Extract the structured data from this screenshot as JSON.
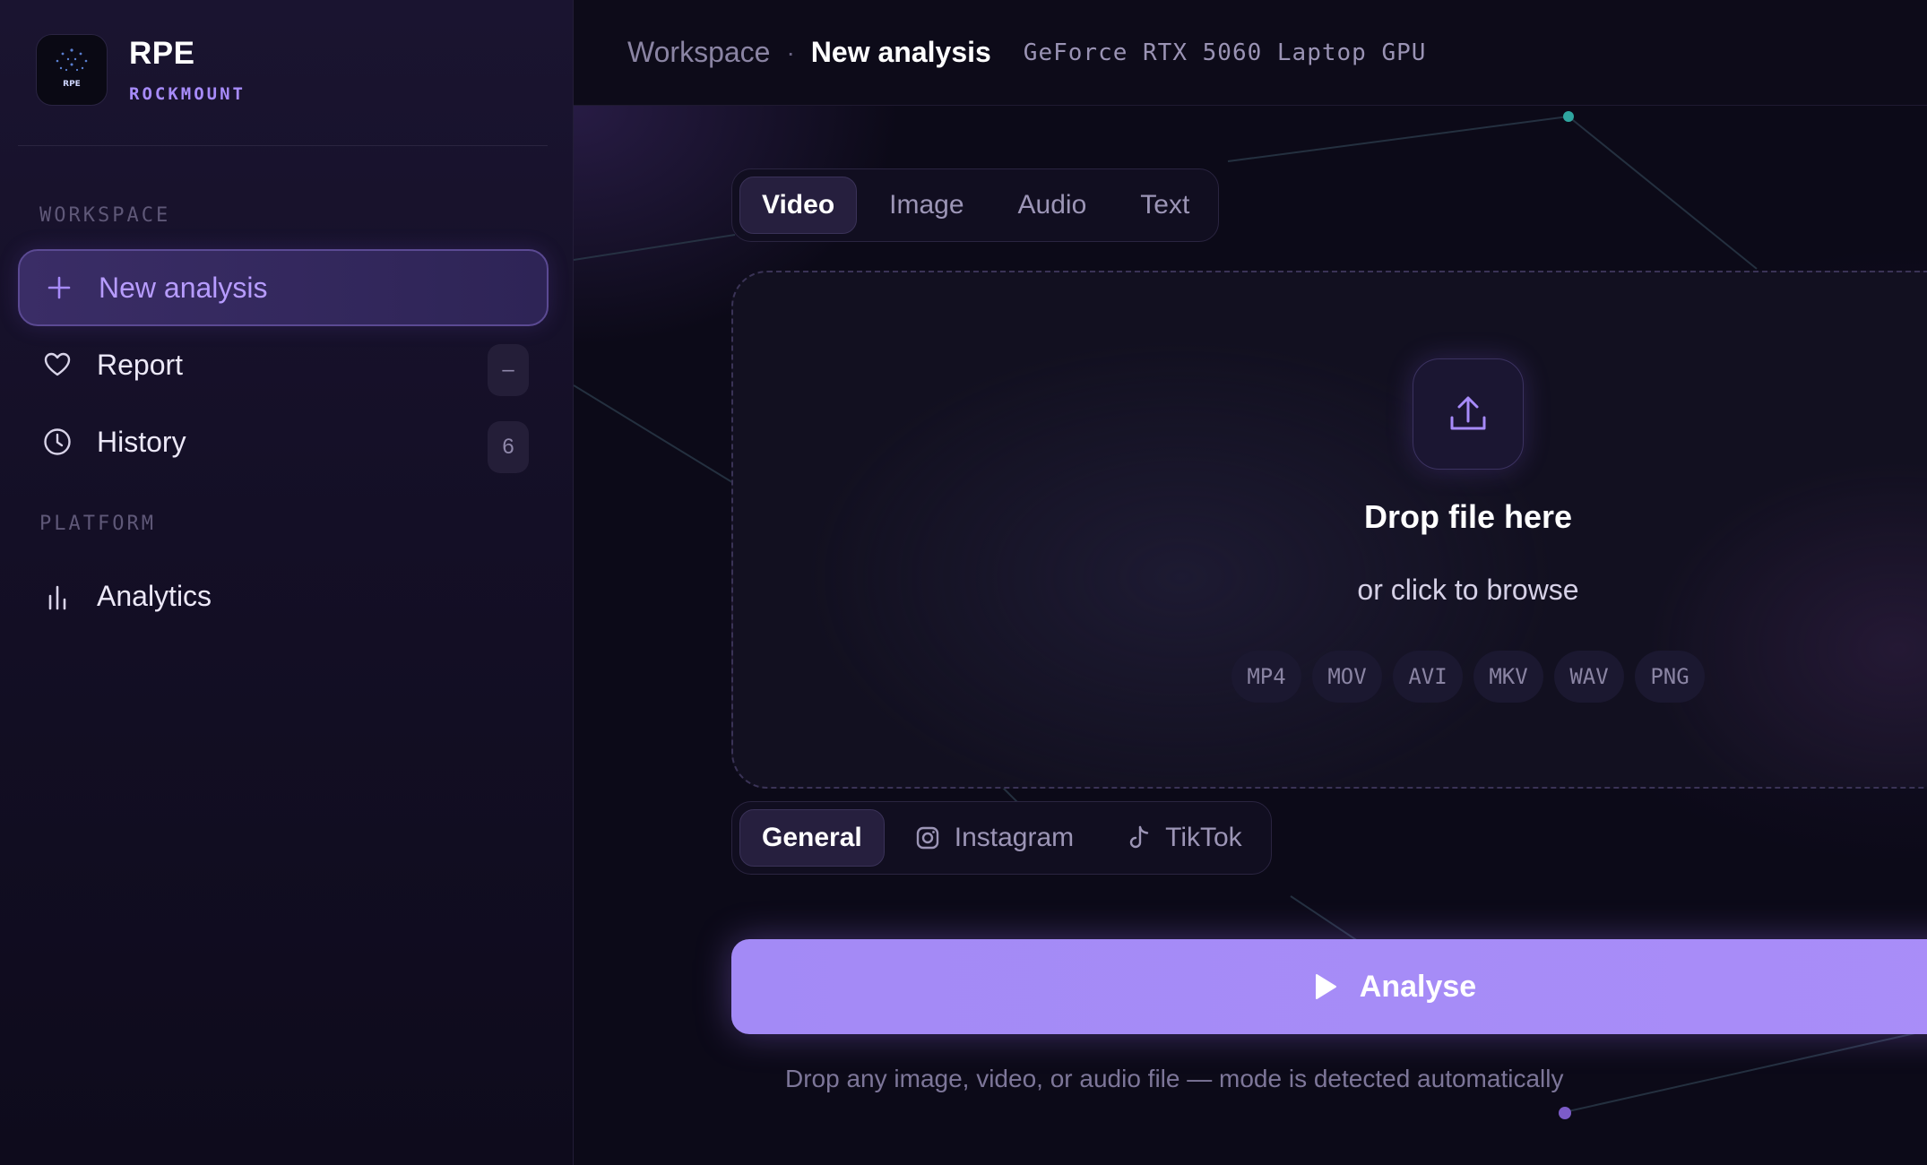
{
  "brand": {
    "name": "RPE",
    "subtitle": "ROCKMOUNT",
    "logo_text": "RPE"
  },
  "sidebar": {
    "sections": [
      {
        "label": "WORKSPACE"
      },
      {
        "label": "PLATFORM"
      }
    ],
    "items": [
      {
        "label": "New analysis",
        "icon": "plus-icon",
        "active": true
      },
      {
        "label": "Report",
        "icon": "heart-icon",
        "badge": "–"
      },
      {
        "label": "History",
        "icon": "clock-icon",
        "badge": "6"
      },
      {
        "label": "Analytics",
        "icon": "bar-chart-icon"
      }
    ]
  },
  "header": {
    "breadcrumb_root": "Workspace",
    "breadcrumb_sep": "·",
    "breadcrumb_current": "New analysis",
    "gpu": "GeForce RTX 5060 Laptop GPU"
  },
  "mode_tabs": [
    {
      "label": "Video",
      "active": true
    },
    {
      "label": "Image"
    },
    {
      "label": "Audio"
    },
    {
      "label": "Text"
    }
  ],
  "dropzone": {
    "icon": "upload-icon",
    "title": "Drop file here",
    "subtitle": "or click to browse",
    "formats": [
      "MP4",
      "MOV",
      "AVI",
      "MKV",
      "WAV",
      "PNG"
    ]
  },
  "platform_tabs": [
    {
      "label": "General",
      "active": true
    },
    {
      "label": "Instagram",
      "icon": "instagram-icon"
    },
    {
      "label": "TikTok",
      "icon": "tiktok-icon"
    }
  ],
  "analyse_button": {
    "label": "Analyse",
    "icon": "play-icon"
  },
  "hint": "Drop any image, video, or audio file — mode is detected automatically",
  "colors": {
    "accent": "#a78bfa",
    "button": "#a38af6",
    "background": "#0c0a18"
  }
}
